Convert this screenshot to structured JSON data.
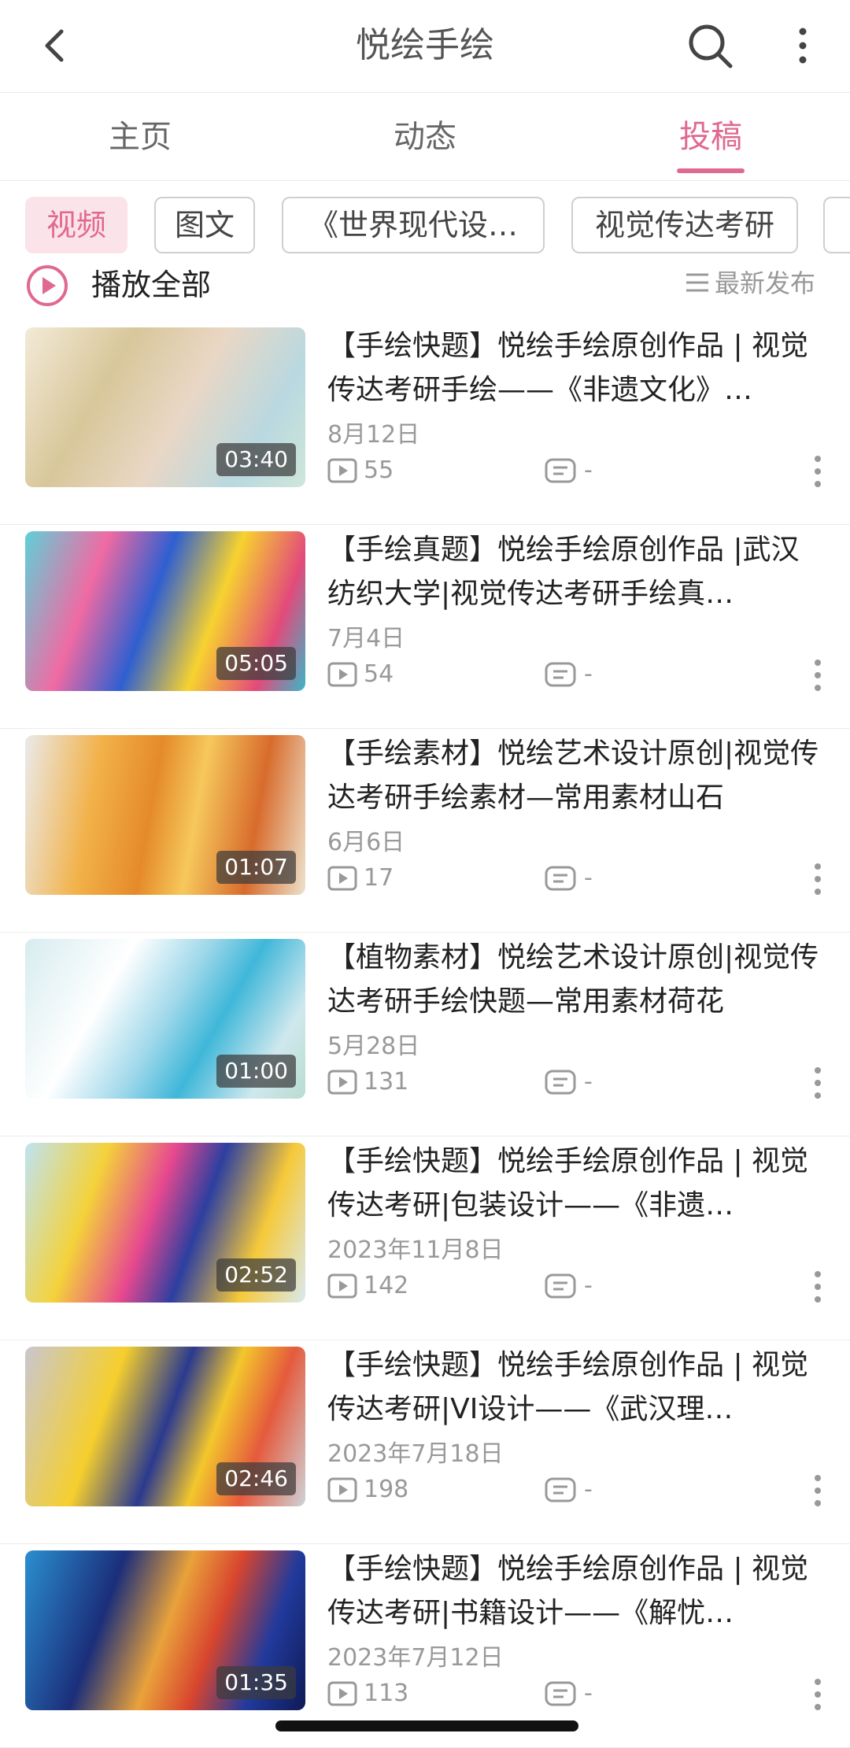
{
  "header": {
    "back_icon": "chevron-left-icon",
    "title": "悦绘手绘",
    "search_icon": "search-icon",
    "more_icon": "more-vertical-icon"
  },
  "tabs": [
    {
      "label": "主页"
    },
    {
      "label": "动态"
    },
    {
      "label": "投稿",
      "active": true
    }
  ],
  "filters": [
    {
      "label": "视频",
      "active": true
    },
    {
      "label": "图文"
    },
    {
      "label": "《世界现代设…"
    },
    {
      "label": "视觉传达考研"
    }
  ],
  "play_all": {
    "label": "播放全部",
    "icon": "play-circle-icon"
  },
  "sort": {
    "label": "最新发布",
    "icon": "sort-lines-icon"
  },
  "videos": [
    {
      "title": "【手绘快题】悦绘手绘原创作品 | 视觉传达考研手绘——《非遗文化》…",
      "date": "8月12日",
      "plays": "55",
      "comments": "-",
      "duration": "03:40"
    },
    {
      "title": "【手绘真题】悦绘手绘原创作品 |武汉纺织大学|视觉传达考研手绘真…",
      "date": "7月4日",
      "plays": "54",
      "comments": "-",
      "duration": "05:05"
    },
    {
      "title": "【手绘素材】悦绘艺术设计原创|视觉传达考研手绘素材—常用素材山石",
      "date": "6月6日",
      "plays": "17",
      "comments": "-",
      "duration": "01:07"
    },
    {
      "title": "【植物素材】悦绘艺术设计原创|视觉传达考研手绘快题—常用素材荷花",
      "date": "5月28日",
      "plays": "131",
      "comments": "-",
      "duration": "01:00"
    },
    {
      "title": "【手绘快题】悦绘手绘原创作品 | 视觉传达考研|包装设计——《非遗…",
      "date": "2023年11月8日",
      "plays": "142",
      "comments": "-",
      "duration": "02:52"
    },
    {
      "title": "【手绘快题】悦绘手绘原创作品 | 视觉传达考研|VI设计——《武汉理…",
      "date": "2023年7月18日",
      "plays": "198",
      "comments": "-",
      "duration": "02:46"
    },
    {
      "title": "【手绘快题】悦绘手绘原创作品 | 视觉传达考研|书籍设计——《解忧…",
      "date": "2023年7月12日",
      "plays": "113",
      "comments": "-",
      "duration": "01:35"
    }
  ],
  "colors": {
    "accent": "#e0698f",
    "chip_active_bg": "#fbe3ea",
    "muted_text": "#999999"
  }
}
